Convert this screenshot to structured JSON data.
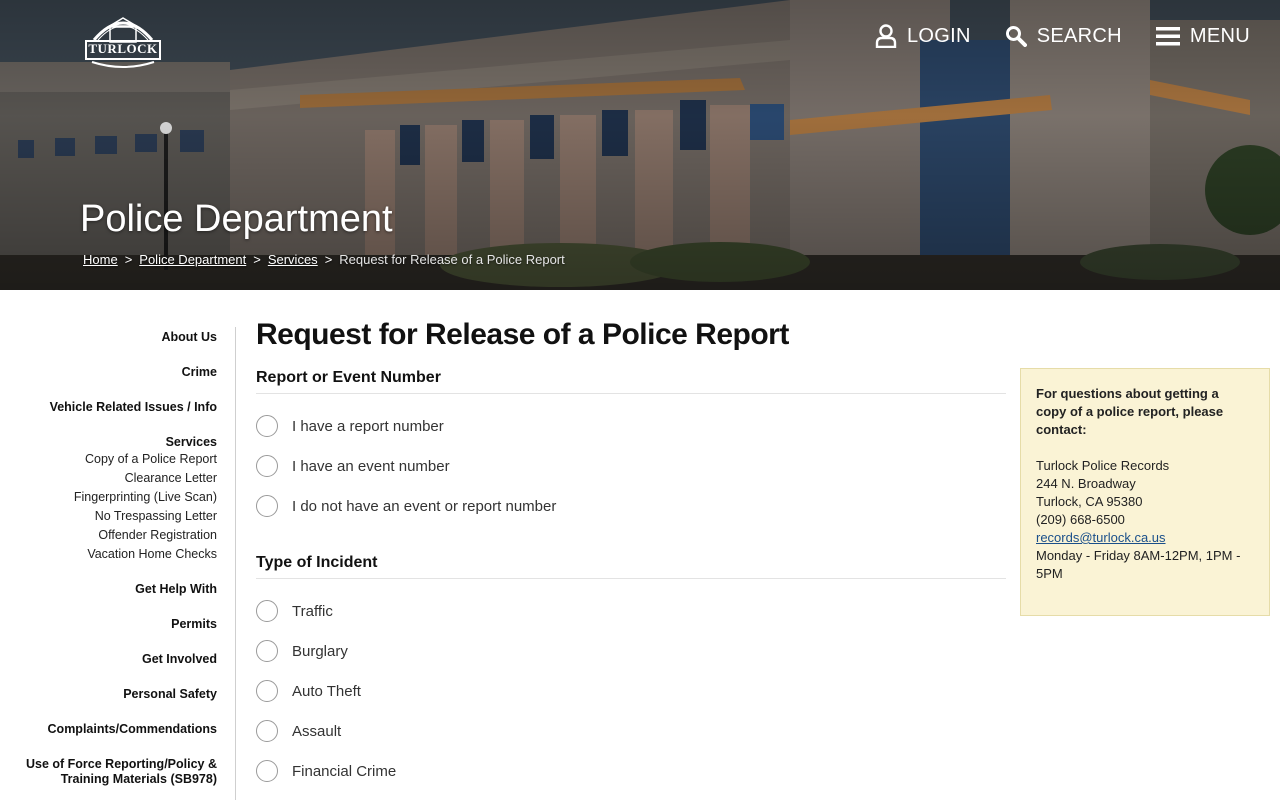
{
  "header": {
    "logo_text": "TURLOCK",
    "nav": [
      {
        "label": "LOGIN",
        "icon": "user-icon"
      },
      {
        "label": "SEARCH",
        "icon": "search-icon"
      },
      {
        "label": "MENU",
        "icon": "hamburger-menu-icon"
      }
    ],
    "page_title": "Police Department",
    "breadcrumb": {
      "home": "Home",
      "police": "Police Department",
      "services": "Services",
      "current": "Request for Release of a Police Report",
      "separator": ">"
    }
  },
  "sidebar": {
    "about": "About Us",
    "crime": "Crime",
    "vehicle": "Vehicle Related Issues / Info",
    "services": "Services",
    "services_items": [
      "Copy of a Police Report",
      "Clearance Letter",
      "Fingerprinting (Live Scan)",
      "No Trespassing Letter",
      "Offender Registration",
      "Vacation Home Checks"
    ],
    "get_help": "Get Help With",
    "permits": "Permits",
    "get_involved": "Get Involved",
    "personal_safety": "Personal Safety",
    "complaints": "Complaints/Commendations",
    "use_of_force_line1": "Use of Force Reporting/Policy &",
    "use_of_force_line2": "Training Materials (SB978)"
  },
  "main": {
    "title": "Request for Release of a Police Report",
    "section1": {
      "title": "Report or Event Number",
      "options": [
        "I have a report number",
        "I have an event number",
        "I do not have an event or report number"
      ]
    },
    "section2": {
      "title": "Type of Incident",
      "options": [
        "Traffic",
        "Burglary",
        "Auto Theft",
        "Assault",
        "Financial Crime"
      ]
    }
  },
  "infobox": {
    "intro_line1": "For questions about getting a",
    "intro_line2": "copy of a police report, please",
    "intro_line3": "contact:",
    "org": "Turlock Police Records",
    "street": "244 N. Broadway",
    "city": "Turlock, CA 95380",
    "phone": "(209) 668-6500",
    "email": "records@turlock.ca.us",
    "hours_line1": "Monday - Friday 8AM-12PM, 1PM -",
    "hours_line2": "5PM"
  },
  "colors": {
    "infobox_bg": "#faf3d5",
    "link": "#1a4f8a"
  }
}
